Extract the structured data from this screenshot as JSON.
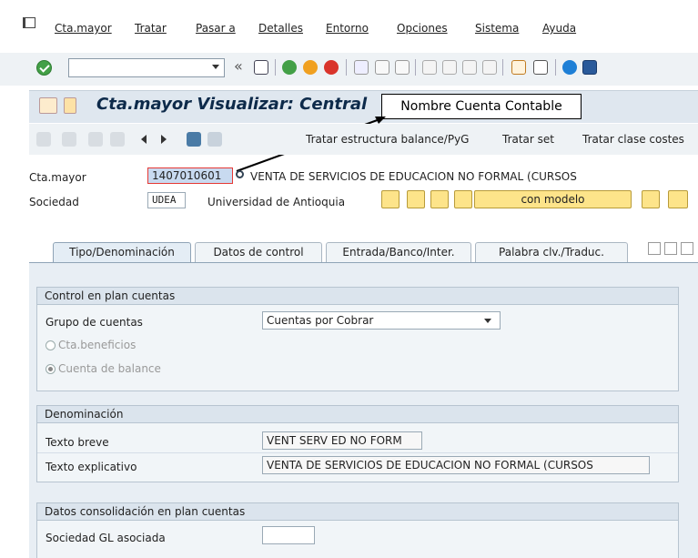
{
  "menu": {
    "items": [
      "Cta.mayor",
      "Tratar",
      "Pasar a",
      "Detalles",
      "Entorno",
      "Opciones",
      "Sistema",
      "Ayuda"
    ]
  },
  "toolbar": {
    "command_value": "",
    "nav_back": "«"
  },
  "header": {
    "title": "Cta.mayor Visualizar: Central",
    "callout": "Nombre Cuenta Contable"
  },
  "toolbar2": {
    "btn_balance": "Tratar estructura balance/PyG",
    "btn_set": "Tratar set",
    "btn_clase": "Tratar clase costes"
  },
  "fields": {
    "cta_label": "Cta.mayor",
    "cta_value": "1407010601",
    "cta_desc": "VENTA DE SERVICIOS DE EDUCACION NO FORMAL (CURSOS",
    "soc_label": "Sociedad",
    "soc_value": "UDEA",
    "soc_desc": "Universidad de Antioquia",
    "btn_modelo": "con modelo"
  },
  "tabs": [
    "Tipo/Denominación",
    "Datos de control",
    "Entrada/Banco/Inter.",
    "Palabra clv./Traduc."
  ],
  "control": {
    "title": "Control en plan cuentas",
    "grupo_label": "Grupo de cuentas",
    "grupo_value": "Cuentas por Cobrar",
    "radio1": "Cta.beneficios",
    "radio2": "Cuenta de balance"
  },
  "denominacion": {
    "title": "Denominación",
    "breve_label": "Texto breve",
    "breve_value": "VENT SERV ED NO FORM",
    "expl_label": "Texto explicativo",
    "expl_value": "VENTA DE SERVICIOS DE EDUCACION NO FORMAL (CURSOS"
  },
  "consolidacion": {
    "title": "Datos consolidación en plan cuentas",
    "sociedad_label": "Sociedad GL asociada",
    "sociedad_value": ""
  },
  "colors": {
    "header_bg": "#dfe7ef",
    "panel_bg": "#e8eef4",
    "title_color": "#0d2a4a",
    "highlight": "#e53935"
  }
}
